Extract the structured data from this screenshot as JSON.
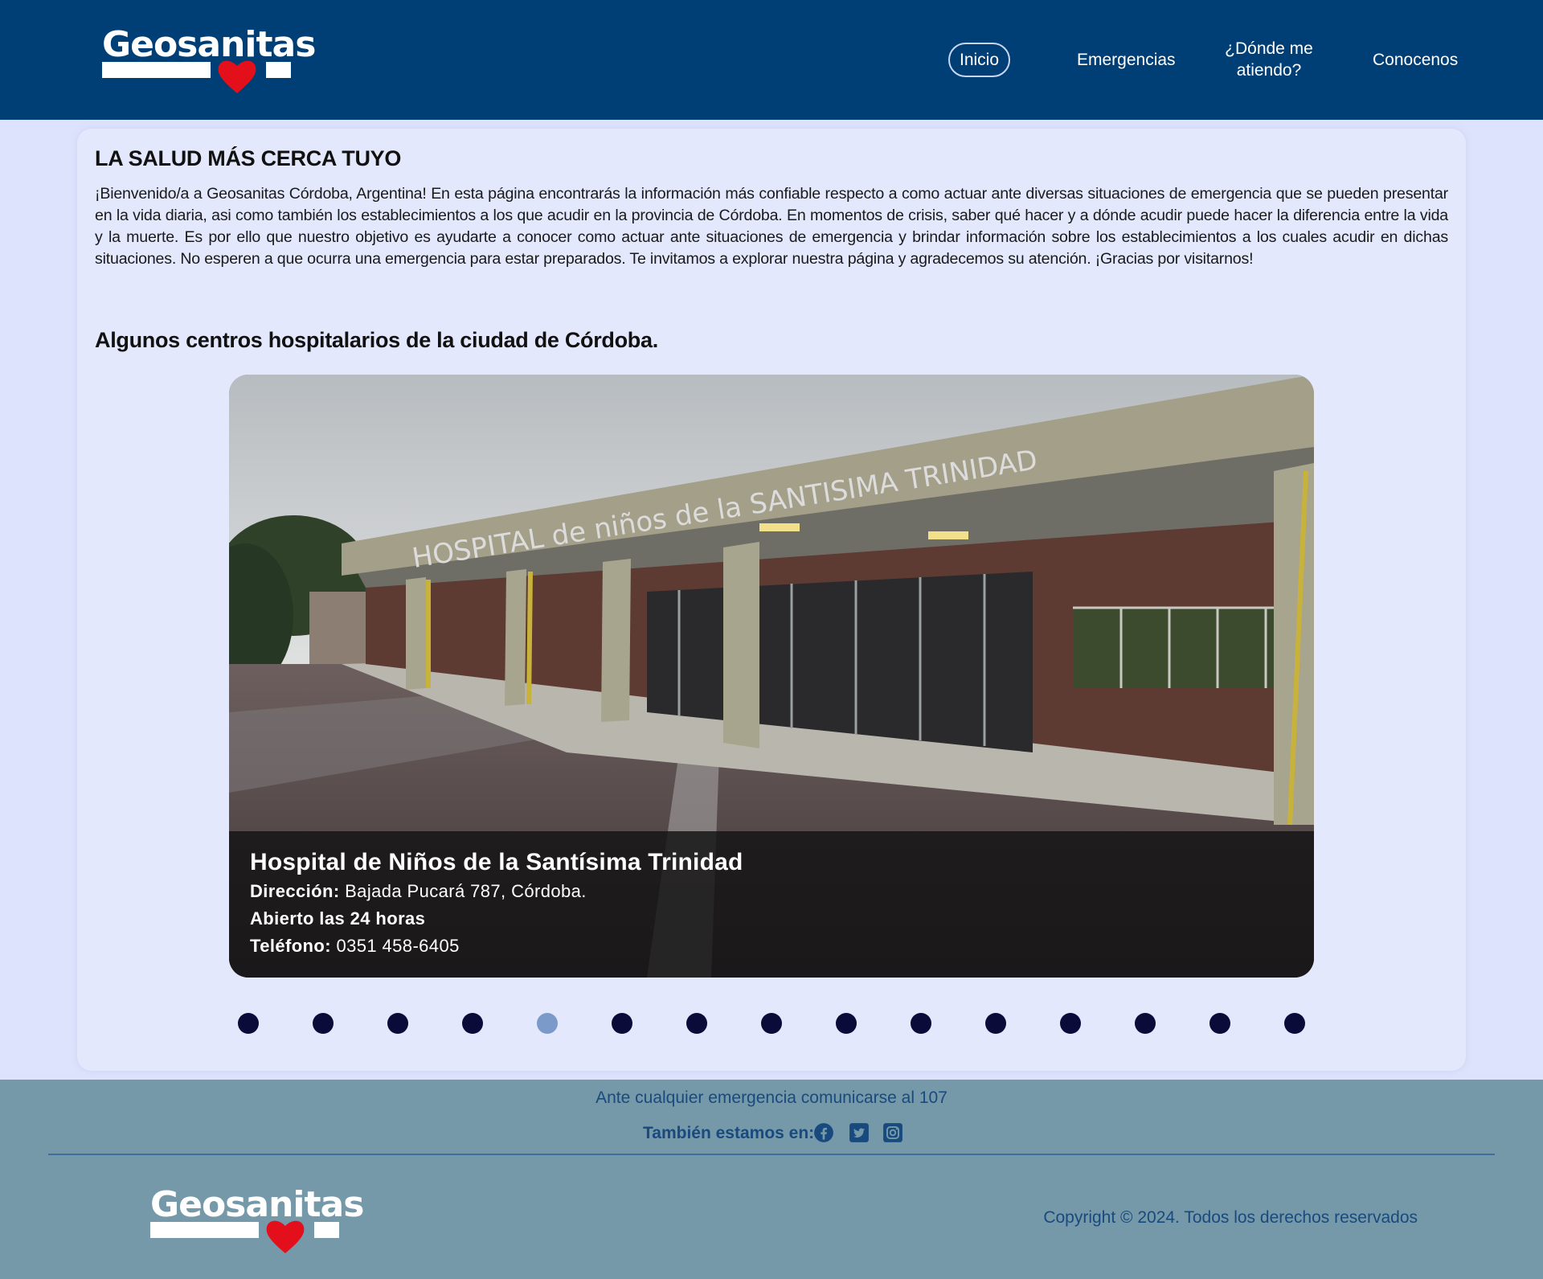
{
  "brand": {
    "logo_text": "Geosanitas",
    "colors": {
      "header": "#003f75",
      "footer": "#7699aa",
      "heart": "#e3101c",
      "dot": "#0b0b3a",
      "dot_active": "#7c9ac9"
    }
  },
  "nav": {
    "items": [
      {
        "label": "Inicio",
        "active": true
      },
      {
        "label": "Emergencias"
      },
      {
        "label": "¿Dónde me",
        "label2": "atiendo?"
      },
      {
        "label": "Conocenos"
      }
    ]
  },
  "main": {
    "title": "LA SALUD MÁS CERCA TUYO",
    "intro": "¡Bienvenido/a a Geosanitas Córdoba, Argentina! En esta página encontrarás la información más confiable respecto a como actuar ante diversas situaciones de emergencia que se pueden presentar en la vida diaria, asi como también los establecimientos a los que acudir en la provincia de Córdoba. En momentos de crisis, saber qué hacer y a dónde acudir puede hacer la diferencia entre la vida y la muerte. Es por ello que nuestro objetivo es ayudarte a conocer como actuar ante situaciones de emergencia y brindar información sobre los establecimientos a los cuales acudir en dichas situaciones. No esperen a que ocurra una emergencia para estar preparados. Te invitamos a explorar nuestra página y agradecemos su atención. ¡Gracias por visitarnos!",
    "subtitle": "Algunos centros hospitalarios de la ciudad de Córdoba."
  },
  "carousel": {
    "slide": {
      "sign_text": "HOSPITAL de niños de la SANTISIMA TRINIDAD",
      "name": "Hospital de Niños de la Santísima Trinidad",
      "address_label": "Dirección:",
      "address": "Bajada Pucará 787, Córdoba.",
      "hours": "Abierto las 24 horas",
      "phone_label": "Teléfono:",
      "phone": "0351 458-6405"
    },
    "slide_count": 15,
    "active_index": 4
  },
  "footer": {
    "emergency": "Ante cualquier emergencia comunicarse al 107",
    "social_label": "También estamos en:",
    "social_icons": [
      "facebook-icon",
      "twitter-icon",
      "instagram-icon"
    ],
    "copyright": "Copyright © 2024. Todos los derechos reservados"
  }
}
